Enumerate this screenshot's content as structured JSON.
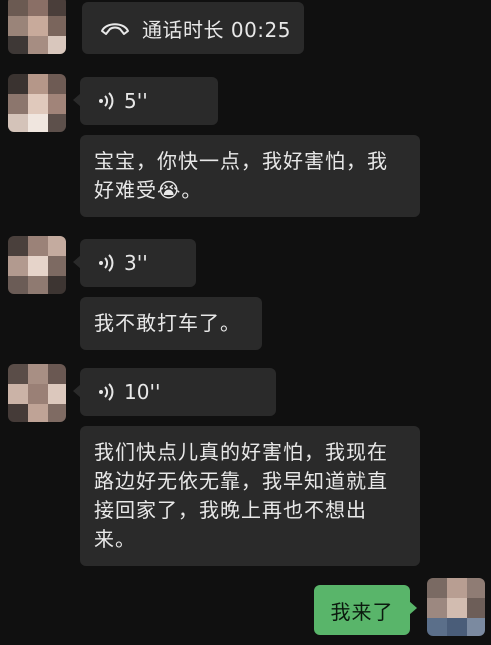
{
  "chat": {
    "call": {
      "label": "通话时长 00:25",
      "icon": "phone-hangup-icon"
    },
    "voice1": {
      "duration": "5''"
    },
    "msg1": {
      "line1": "宝宝，你快一点，我好害怕，我",
      "line2": "好难受😭。"
    },
    "voice2": {
      "duration": "3''"
    },
    "msg2": {
      "text": "我不敢打车了。"
    },
    "voice3": {
      "duration": "10''"
    },
    "msg3": {
      "line1": "我们快点儿真的好害怕，我现在",
      "line2": "路边好无依无靠，我早知道就直",
      "line3": "接回家了，我晚上再也不想出",
      "line4": "来。"
    },
    "reply": {
      "text": "我来了"
    }
  },
  "colors": {
    "background": "#101010",
    "bubble": "#2a2a2a",
    "sent_bubble": "#59b56a",
    "text": "#e8e8e8"
  }
}
